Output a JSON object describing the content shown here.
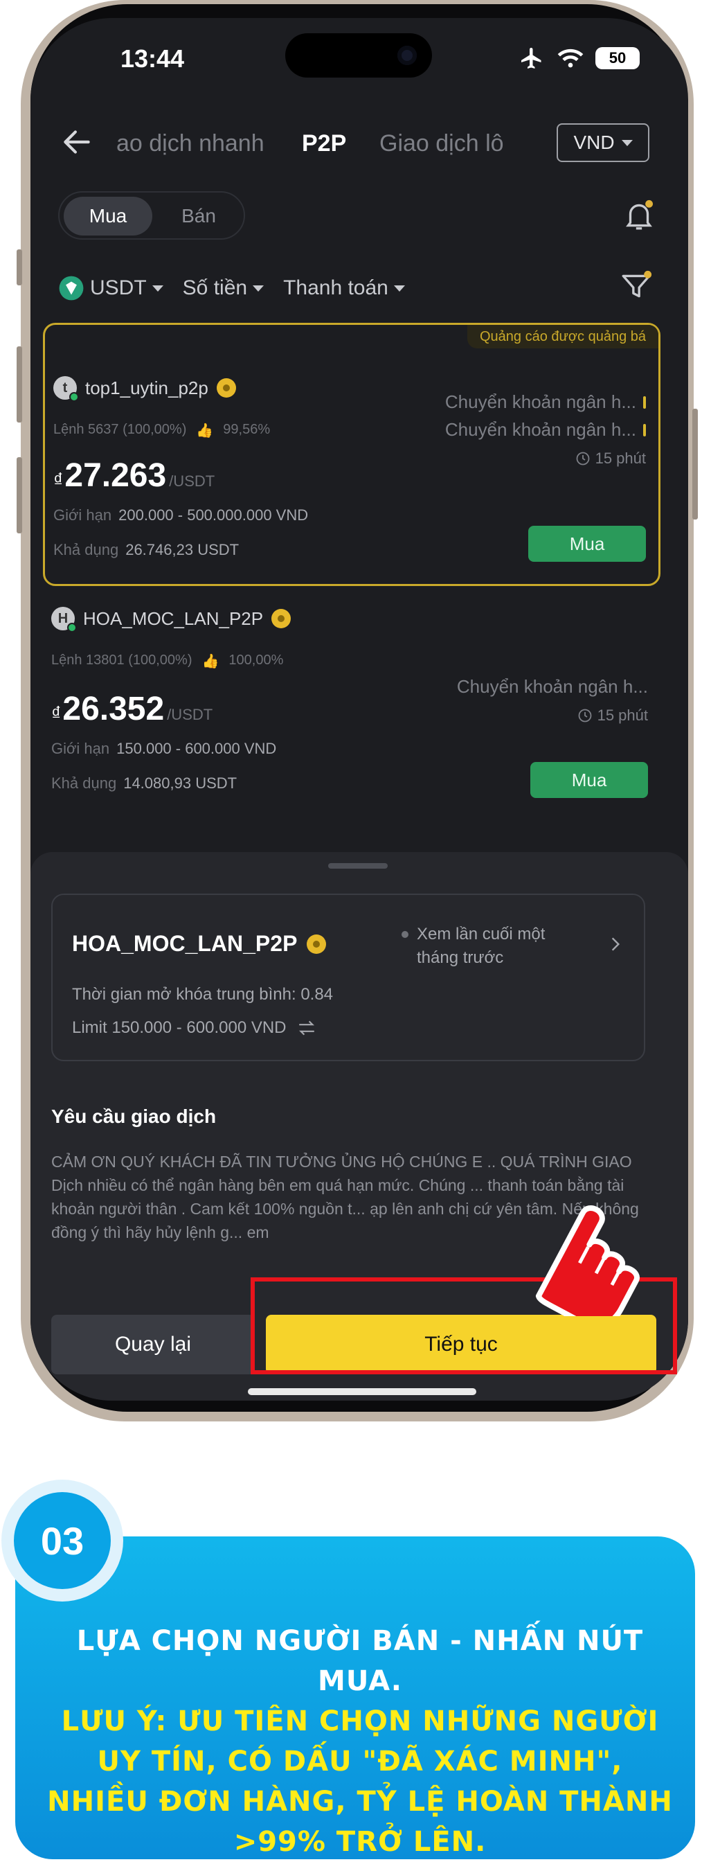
{
  "status_bar": {
    "time": "13:44",
    "battery": "50"
  },
  "nav": {
    "tabs": [
      "ao dịch nhanh",
      "P2P",
      "Giao dịch lô"
    ],
    "active_tab": "P2P",
    "currency": "VND"
  },
  "toggle": {
    "buy": "Mua",
    "sell": "Bán"
  },
  "filters": {
    "coin": "USDT",
    "amount": "Số tiền",
    "payment": "Thanh toán"
  },
  "offers": [
    {
      "ad_badge": "Quảng cáo được quảng bá",
      "avatar_letter": "t",
      "seller": "top1_uytin_p2p",
      "orders": "Lệnh 5637 (100,00%)",
      "rating": "99,56%",
      "currency_symbol": "₫",
      "price": "27.263",
      "price_unit": "/USDT",
      "limit_label": "Giới hạn",
      "limit": "200.000 - 500.000.000 VND",
      "available_label": "Khả dụng",
      "available": "26.746,23 USDT",
      "payments": [
        "Chuyển khoản ngân h...",
        "Chuyển khoản ngân h..."
      ],
      "time_limit": "15 phút",
      "buy_label": "Mua"
    },
    {
      "avatar_letter": "H",
      "seller": "HOA_MOC_LAN_P2P",
      "orders": "Lệnh 13801 (100,00%)",
      "rating": "100,00%",
      "currency_symbol": "₫",
      "price": "26.352",
      "price_unit": "/USDT",
      "limit_label": "Giới hạn",
      "limit": "150.000 - 600.000 VND",
      "available_label": "Khả dụng",
      "available": "14.080,93 USDT",
      "payments": [
        "Chuyển khoản ngân h..."
      ],
      "time_limit": "15 phút",
      "buy_label": "Mua"
    }
  ],
  "sheet": {
    "seller_name": "HOA_MOC_LAN_P2P",
    "last_seen": "Xem lần cuối một tháng trước",
    "unlock_time": "Thời gian mở khóa trung bình: 0.84",
    "limit": "Limit 150.000 - 600.000 VND",
    "requirements_title": "Yêu cầu giao dịch",
    "requirements_text": "CẢM ƠN QUÝ KHÁCH ĐÃ TIN TƯỞNG ỦNG HỘ CHÚNG E .. QUÁ TRÌNH GIAO Dịch nhiều có thể ngân hàng bên em quá hạn mức. Chúng ... thanh toán bằng tài khoản người thân . Cam kết 100% nguồn t... ạp lên anh chị cứ yên tâm. Nếu không đồng ý thì hãy hủy lệnh g... em",
    "back_label": "Quay lại",
    "continue_label": "Tiếp tục"
  },
  "caption": {
    "step": "03",
    "line1": "LỰA CHỌN NGƯỜI BÁN - NHẤN NÚT MUA.",
    "line2": "LƯU Ý: ƯU TIÊN CHỌN NHỮNG NGƯỜI UY TÍN, CÓ DẤU \"ĐÃ XÁC MINH\", NHIỀU ĐƠN HÀNG, TỶ LỆ HOÀN THÀNH >99% TRỞ LÊN."
  },
  "colors": {
    "accent_yellow": "#f6d32b",
    "buy_green": "#2a9a5a",
    "highlight_red": "#e8141c",
    "caption_blue": "#0aa4e6",
    "caption_yellow": "#ffec18"
  }
}
